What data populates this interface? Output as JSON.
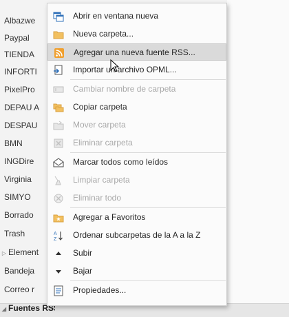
{
  "folders": [
    {
      "label": "Albazwe"
    },
    {
      "label": "Paypal"
    },
    {
      "label": "TIENDA"
    },
    {
      "label": "INFORTI"
    },
    {
      "label": "PixelPro"
    },
    {
      "label": "DEPAU A"
    },
    {
      "label": "DESPAU"
    },
    {
      "label": "BMN"
    },
    {
      "label": "INGDire"
    },
    {
      "label": "Virginia"
    },
    {
      "label": "SIMYO"
    },
    {
      "label": "Borrado"
    },
    {
      "label": "Trash"
    },
    {
      "label": "Element"
    },
    {
      "label": "Bandeja"
    },
    {
      "label": "Correo r"
    },
    {
      "label": "Fuentes RSS"
    }
  ],
  "context_menu": {
    "items": [
      {
        "label": "Abrir en ventana nueva",
        "icon": "new-window-icon",
        "enabled": true
      },
      {
        "label": "Nueva carpeta...",
        "icon": "folder-icon",
        "enabled": true
      },
      {
        "label": "Agregar una nueva fuente RSS...",
        "icon": "rss-icon",
        "enabled": true,
        "highlighted": true
      },
      {
        "label": "Importar un archivo OPML...",
        "icon": "import-icon",
        "enabled": true
      },
      {
        "label": "Cambiar nombre de carpeta",
        "icon": "rename-icon",
        "enabled": false
      },
      {
        "label": "Copiar carpeta",
        "icon": "copy-folder-icon",
        "enabled": true
      },
      {
        "label": "Mover carpeta",
        "icon": "move-folder-icon",
        "enabled": false
      },
      {
        "label": "Eliminar carpeta",
        "icon": "delete-folder-icon",
        "enabled": false
      },
      {
        "label": "Marcar todos como leídos",
        "icon": "mark-read-icon",
        "enabled": true
      },
      {
        "label": "Limpiar carpeta",
        "icon": "clean-folder-icon",
        "enabled": false
      },
      {
        "label": "Eliminar todo",
        "icon": "delete-all-icon",
        "enabled": false
      },
      {
        "label": "Agregar a Favoritos",
        "icon": "favorites-icon",
        "enabled": true
      },
      {
        "label": "Ordenar subcarpetas de la A a la Z",
        "icon": "sort-az-icon",
        "enabled": true
      },
      {
        "label": "Subir",
        "icon": "up-arrow-icon",
        "enabled": true
      },
      {
        "label": "Bajar",
        "icon": "down-arrow-icon",
        "enabled": true
      },
      {
        "label": "Propiedades...",
        "icon": "properties-icon",
        "enabled": true
      }
    ]
  },
  "colors": {
    "menu_bg": "#fbfbfb",
    "highlight_bg": "#dadada",
    "disabled_text": "#a8a8a8",
    "rss_orange": "#f0a030",
    "folder_yellow": "#f2c060",
    "icon_blue": "#2d6fb8"
  }
}
